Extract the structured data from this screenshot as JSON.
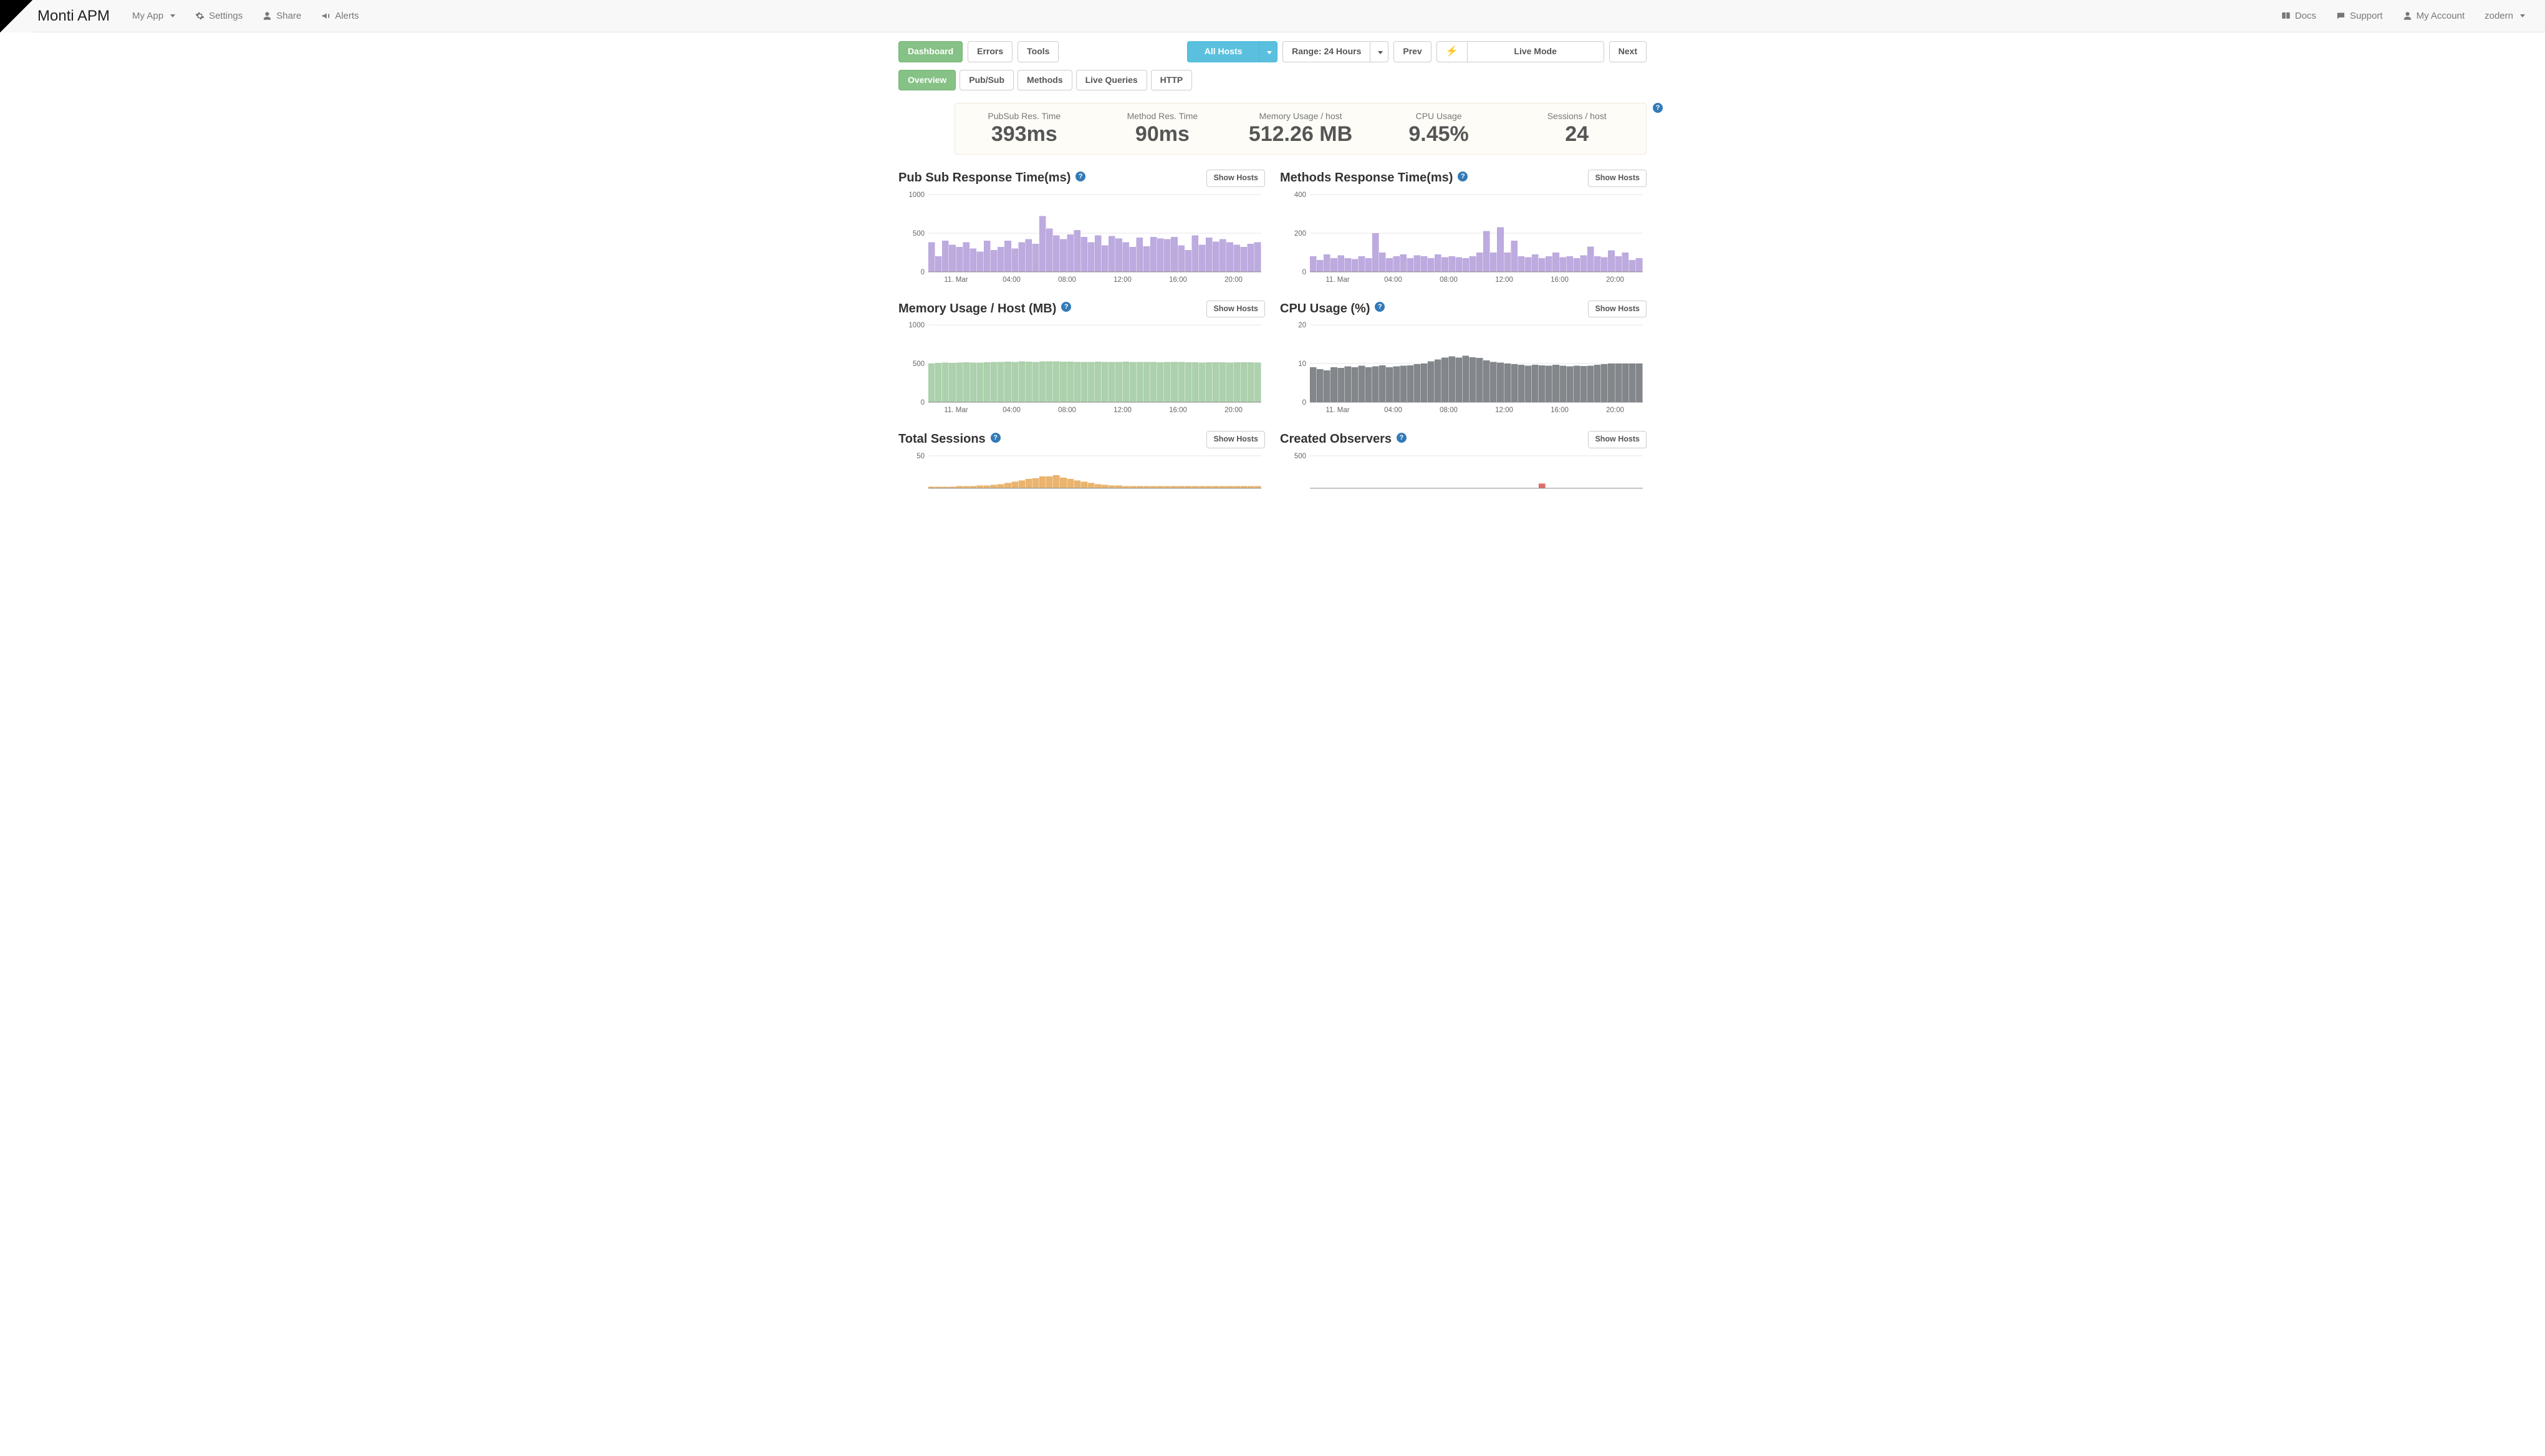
{
  "brand": "Monti APM",
  "nav": {
    "app_selector": "My App",
    "left": {
      "settings": "Settings",
      "share": "Share",
      "alerts": "Alerts"
    },
    "right": {
      "docs": "Docs",
      "support": "Support",
      "my_account": "My Account",
      "user": "zodern"
    }
  },
  "toolbar": {
    "pages": {
      "dashboard": "Dashboard",
      "errors": "Errors",
      "tools": "Tools"
    },
    "hosts_label": "All Hosts",
    "range_label": "Range: 24 Hours",
    "prev": "Prev",
    "live_mode": "Live Mode",
    "next": "Next"
  },
  "tabs": {
    "overview": "Overview",
    "pubsub": "Pub/Sub",
    "methods": "Methods",
    "live_queries": "Live Queries",
    "http": "HTTP"
  },
  "summary": {
    "pubsub_rt": {
      "label": "PubSub Res. Time",
      "value": "393ms"
    },
    "method_rt": {
      "label": "Method Res. Time",
      "value": "90ms"
    },
    "memory": {
      "label": "Memory Usage / host",
      "value": "512.26 MB"
    },
    "cpu": {
      "label": "CPU Usage",
      "value": "9.45%"
    },
    "sessions": {
      "label": "Sessions / host",
      "value": "24"
    }
  },
  "show_hosts": "Show Hosts",
  "help_glyph": "?",
  "charts": {
    "pubsub": {
      "title": "Pub Sub Response Time(ms)",
      "color": "#b19cd9",
      "y_ticks": [
        0,
        500,
        1000
      ],
      "x_ticks": [
        "11. Mar",
        "04:00",
        "08:00",
        "12:00",
        "16:00",
        "20:00"
      ]
    },
    "methods": {
      "title": "Methods Response Time(ms)",
      "color": "#b19cd9",
      "y_ticks": [
        0,
        200,
        400
      ],
      "x_ticks": [
        "11. Mar",
        "04:00",
        "08:00",
        "12:00",
        "16:00",
        "20:00"
      ]
    },
    "memory": {
      "title": "Memory Usage / Host (MB)",
      "color": "#9fc99f",
      "y_ticks": [
        0,
        500,
        1000
      ],
      "x_ticks": [
        "11. Mar",
        "04:00",
        "08:00",
        "12:00",
        "16:00",
        "20:00"
      ]
    },
    "cpu": {
      "title": "CPU Usage (%)",
      "color": "#6d7278",
      "y_ticks": [
        0,
        10,
        20
      ],
      "x_ticks": [
        "11. Mar",
        "04:00",
        "08:00",
        "12:00",
        "16:00",
        "20:00"
      ]
    },
    "sessions": {
      "title": "Total Sessions",
      "color": "#e6a756",
      "y_ticks": [
        50
      ],
      "x_ticks": []
    },
    "observers": {
      "title": "Created Observers",
      "color": "#d9534f",
      "y_ticks": [
        500
      ],
      "x_ticks": []
    }
  },
  "chart_data": [
    {
      "id": "pubsub",
      "type": "bar",
      "title": "Pub Sub Response Time(ms)",
      "ylabel": "ms",
      "ylim": [
        0,
        1000
      ],
      "x_ticks": [
        "11. Mar",
        "04:00",
        "08:00",
        "12:00",
        "16:00",
        "20:00"
      ],
      "values": [
        380,
        200,
        400,
        350,
        320,
        380,
        300,
        260,
        400,
        280,
        320,
        400,
        300,
        380,
        420,
        360,
        720,
        560,
        470,
        420,
        480,
        540,
        450,
        380,
        470,
        340,
        460,
        430,
        380,
        320,
        440,
        330,
        450,
        430,
        420,
        450,
        340,
        280,
        470,
        350,
        440,
        390,
        420,
        380,
        350,
        320,
        360,
        380
      ]
    },
    {
      "id": "methods",
      "type": "bar",
      "title": "Methods Response Time(ms)",
      "ylabel": "ms",
      "ylim": [
        0,
        400
      ],
      "x_ticks": [
        "11. Mar",
        "04:00",
        "08:00",
        "12:00",
        "16:00",
        "20:00"
      ],
      "values": [
        80,
        60,
        90,
        70,
        85,
        70,
        65,
        80,
        70,
        200,
        100,
        70,
        80,
        90,
        70,
        85,
        80,
        70,
        90,
        75,
        80,
        75,
        70,
        80,
        100,
        210,
        100,
        230,
        100,
        160,
        80,
        75,
        90,
        70,
        80,
        100,
        75,
        80,
        70,
        85,
        130,
        80,
        75,
        110,
        80,
        100,
        60,
        70
      ]
    },
    {
      "id": "memory",
      "type": "bar",
      "title": "Memory Usage / Host (MB)",
      "ylabel": "MB",
      "ylim": [
        0,
        1000
      ],
      "x_ticks": [
        "11. Mar",
        "04:00",
        "08:00",
        "12:00",
        "16:00",
        "20:00"
      ],
      "values": [
        500,
        505,
        510,
        508,
        512,
        515,
        512,
        510,
        515,
        518,
        520,
        522,
        520,
        525,
        522,
        520,
        525,
        528,
        526,
        524,
        522,
        520,
        518,
        520,
        522,
        520,
        518,
        520,
        522,
        520,
        518,
        520,
        518,
        516,
        518,
        520,
        518,
        516,
        514,
        512,
        514,
        516,
        514,
        512,
        514,
        516,
        514,
        512
      ]
    },
    {
      "id": "cpu",
      "type": "bar",
      "title": "CPU Usage (%)",
      "ylabel": "%",
      "ylim": [
        0,
        20
      ],
      "x_ticks": [
        "11. Mar",
        "04:00",
        "08:00",
        "12:00",
        "16:00",
        "20:00"
      ],
      "values": [
        9,
        8.5,
        8.2,
        9,
        8.8,
        9.2,
        9,
        9.4,
        9,
        9.2,
        9.5,
        9,
        9.2,
        9.4,
        9.5,
        9.8,
        10,
        10.5,
        11,
        11.5,
        11.8,
        11.5,
        12,
        11.6,
        11.4,
        10.8,
        10.4,
        10.2,
        10,
        9.8,
        9.6,
        9.4,
        9.6,
        9.5,
        9.4,
        9.6,
        9.4,
        9.2,
        9.4,
        9.3,
        9.4,
        9.6,
        9.8,
        10,
        10,
        10,
        10,
        10
      ]
    },
    {
      "id": "sessions",
      "type": "bar",
      "title": "Total Sessions",
      "ylim": [
        0,
        50
      ],
      "values": [
        2,
        2,
        2,
        2,
        3,
        3,
        3,
        4,
        4,
        5,
        6,
        8,
        10,
        12,
        14,
        15,
        18,
        18,
        20,
        16,
        14,
        12,
        10,
        8,
        6,
        5,
        4,
        4,
        3,
        3,
        3,
        3,
        3,
        3,
        3,
        3,
        3,
        3,
        3,
        3,
        3,
        3,
        3,
        3,
        3,
        3,
        3,
        3
      ]
    },
    {
      "id": "observers",
      "type": "bar",
      "title": "Created Observers",
      "ylim": [
        0,
        500
      ],
      "values": [
        0,
        0,
        0,
        0,
        0,
        0,
        0,
        0,
        0,
        0,
        0,
        0,
        0,
        0,
        0,
        0,
        0,
        0,
        0,
        0,
        0,
        0,
        0,
        0,
        0,
        0,
        0,
        0,
        0,
        0,
        0,
        0,
        0,
        70,
        0,
        0,
        0,
        0,
        0,
        0,
        0,
        0,
        0,
        0,
        0,
        0,
        0,
        0
      ]
    }
  ]
}
